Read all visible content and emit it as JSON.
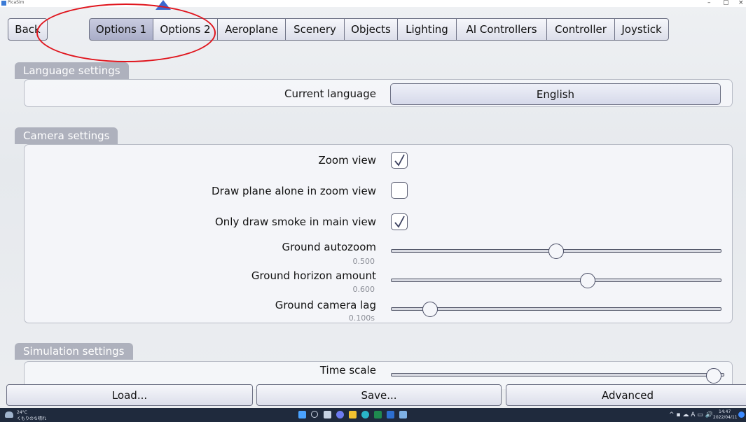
{
  "window": {
    "title": "PicaSim",
    "controls": [
      "–",
      "▢",
      "×"
    ]
  },
  "nav": {
    "back_label": "Back",
    "tabs": [
      "Options 1",
      "Options 2",
      "Aeroplane",
      "Scenery",
      "Objects",
      "Lighting",
      "AI Controllers",
      "Controller",
      "Joystick"
    ],
    "active_tab": "Options 1"
  },
  "language": {
    "section_title": "Language settings",
    "current_language_label": "Current language",
    "current_language_value": "English"
  },
  "camera": {
    "section_title": "Camera settings",
    "zoom_view": {
      "label": "Zoom view",
      "checked": true
    },
    "draw_plane_alone": {
      "label": "Draw plane alone in zoom view",
      "checked": false
    },
    "only_draw_smoke": {
      "label": "Only draw smoke in main view",
      "checked": true
    },
    "ground_autozoom": {
      "label": "Ground autozoom",
      "value_text": "0.500",
      "fraction": 0.5
    },
    "ground_horizon": {
      "label": "Ground horizon amount",
      "value_text": "0.600",
      "fraction": 0.6
    },
    "ground_camera_lag": {
      "label": "Ground camera lag",
      "value_text": "0.100s",
      "fraction": 0.1
    }
  },
  "simulation": {
    "section_title": "Simulation settings",
    "time_scale": {
      "label": "Time scale",
      "fraction": 1.0
    }
  },
  "footer": {
    "load_label": "Load...",
    "save_label": "Save...",
    "advanced_label": "Advanced"
  },
  "taskbar": {
    "weather_temp": "24°C",
    "weather_desc": "くもりのち晴れ",
    "time": "14:47",
    "date": "2022/04/11"
  },
  "colors": {
    "annotation_ellipse": "#e0151d",
    "annotation_arrow": "#3b67d0",
    "section_header": "#aeb1bd",
    "active_tab": "#b4b8d0"
  }
}
